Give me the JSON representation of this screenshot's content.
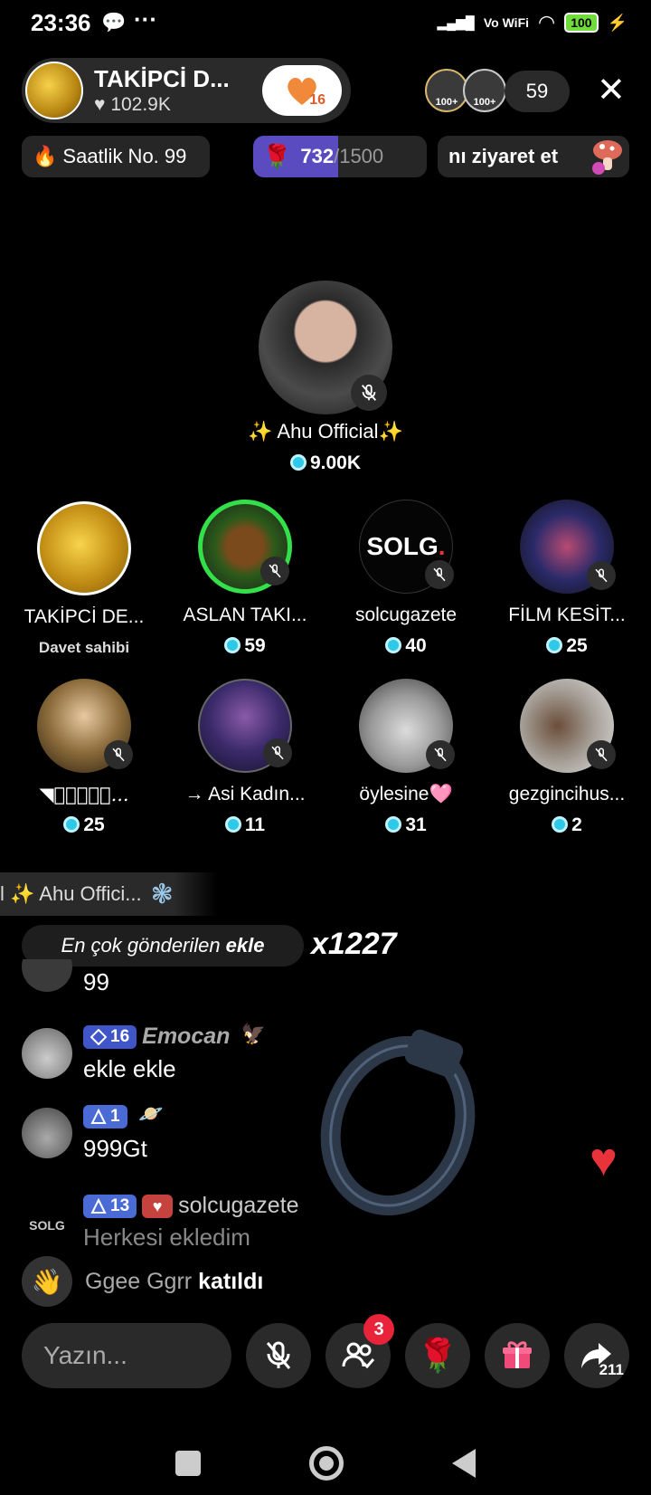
{
  "status_bar": {
    "time": "23:36",
    "dots": "···",
    "network": "Vo WiFi",
    "battery": "100"
  },
  "host": {
    "name": "TAKİPCİ D...",
    "likes": "102.9K",
    "follow_level": "16"
  },
  "top_viewers": [
    "100+",
    "100+"
  ],
  "viewer_count": "59",
  "chips": {
    "rank": "Saatlik No. 99",
    "goal_current": "732",
    "goal_max": "/1500",
    "goal_progress": 0.488,
    "visit": "nı ziyaret et"
  },
  "main_speaker": {
    "name": "✨ Ahu Official✨",
    "coins": "9.00K"
  },
  "guests": [
    {
      "name": "TAKİPCİ DE...",
      "label": "Davet sahibi",
      "coins": ""
    },
    {
      "name": "ASLAN TAKI...",
      "coins": "59"
    },
    {
      "name": "solcugazete",
      "coins": "40",
      "logo": "SOLG"
    },
    {
      "name": "FİLM KESİT...",
      "coins": "25"
    },
    {
      "name": "◥ꦿ𝑲𝒂𝑴𝒆...",
      "coins": "25"
    },
    {
      "name": "→ Asi Kadın...",
      "coins": "11"
    },
    {
      "name": "öylesine🩷",
      "coins": "31"
    },
    {
      "name": "gezgincihus...",
      "coins": "2"
    }
  ],
  "banner": "l ✨ Ahu Offici...",
  "gift_combo": {
    "text": "En çok gönderilen",
    "bold": "ekle",
    "count": "x1227"
  },
  "chat": [
    {
      "user": "",
      "level": "",
      "text": "99"
    },
    {
      "user": "Emocan",
      "level": "16",
      "text": "ekle ekle"
    },
    {
      "user": "",
      "level": "1",
      "text": "999Gt"
    },
    {
      "user": "solcugazete",
      "level": "13",
      "text": "Herkesi ekledim",
      "avatar": "SOLG"
    }
  ],
  "joined": {
    "who": "Ggee Ggrr",
    "action": "katıldı"
  },
  "bottom_bar": {
    "input_placeholder": "Yazın...",
    "guests_badge": "3",
    "share_count": "211"
  },
  "colors": {
    "background": "#000000",
    "goal_fill": "#5b4bc0",
    "badge_red": "#e8233a",
    "coin": "#2ec8e8"
  }
}
